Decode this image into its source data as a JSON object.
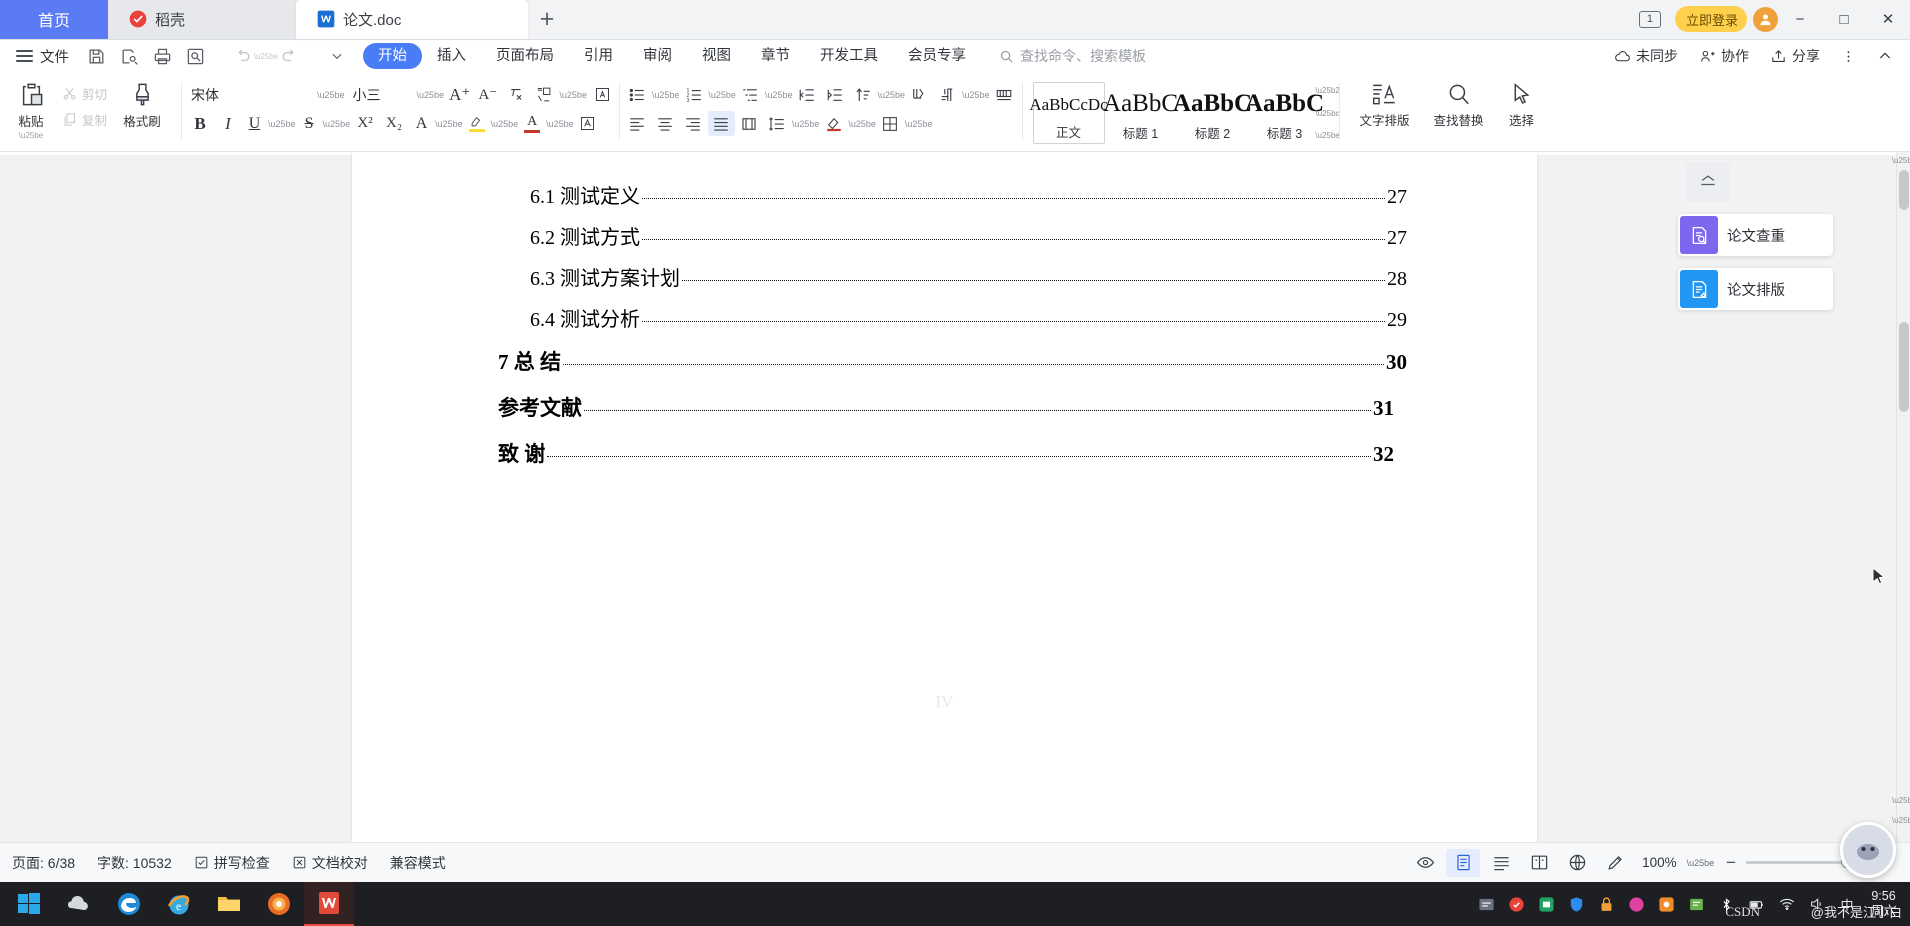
{
  "window": {
    "tabs": [
      {
        "label": "首页",
        "icon": "home-icon",
        "state": "home"
      },
      {
        "label": "稻壳",
        "icon": "docer-icon",
        "state": "inactive"
      },
      {
        "label": "论文.doc",
        "icon": "wps-word-icon",
        "state": "active"
      }
    ],
    "new_tab_label": "+",
    "tab_count_badge": "1",
    "login_label": "立即登录",
    "avatar_label": "人",
    "minimize": "−",
    "maximize": "□",
    "close": "✕"
  },
  "menubar": {
    "file_label": "文件",
    "quick_access": [
      "save-icon",
      "save-as-icon",
      "print-icon",
      "print-preview-icon",
      "undo-icon",
      "redo-icon",
      "customize-icon"
    ],
    "tabs": [
      {
        "label": "开始",
        "selected": true
      },
      {
        "label": "插入",
        "selected": false
      },
      {
        "label": "页面布局",
        "selected": false
      },
      {
        "label": "引用",
        "selected": false
      },
      {
        "label": "审阅",
        "selected": false
      },
      {
        "label": "视图",
        "selected": false
      },
      {
        "label": "章节",
        "selected": false
      },
      {
        "label": "开发工具",
        "selected": false
      },
      {
        "label": "会员专享",
        "selected": false
      }
    ],
    "search_placeholder": "查找命令、搜索模板",
    "right": [
      {
        "label": "未同步",
        "icon": "cloud-sync-icon"
      },
      {
        "label": "协作",
        "icon": "collaborate-icon"
      },
      {
        "label": "分享",
        "icon": "share-icon"
      }
    ],
    "more_icon": "more-vertical-icon",
    "collapse_icon": "chevron-up-icon"
  },
  "ribbon": {
    "paste_label": "粘贴",
    "cut_label": "剪切",
    "copy_label": "复制",
    "format_painter_label": "格式刷",
    "font_name": "宋体",
    "font_size": "小三",
    "grow_font": "A⁺",
    "shrink_font": "A⁻",
    "clear_format": "clear-format-icon",
    "pinyin_guide": "pinyin-icon",
    "bold": "B",
    "italic": "I",
    "underline": "U",
    "strikethrough": "S",
    "superscript": "X²",
    "subscript": "X₂",
    "text_effect": "A",
    "highlight": "A",
    "font_color": "A",
    "char_border": "A",
    "styles": [
      {
        "preview": "AaBbCcDc",
        "name": "正文",
        "current": true
      },
      {
        "preview": "AaBbC",
        "name": "标题 1",
        "current": false
      },
      {
        "preview": "AaBbC",
        "name": "标题 2",
        "current": false
      },
      {
        "preview": "AaBbC",
        "name": "标题 3",
        "current": false
      }
    ],
    "text_layout_label": "文字排版",
    "find_replace_label": "查找替换",
    "select_label": "选择"
  },
  "document": {
    "toc": [
      {
        "text": "6.1 测试定义",
        "page": "27",
        "level": 2
      },
      {
        "text": "6.2 测试方式",
        "page": "27",
        "level": 2
      },
      {
        "text": "6.3 测试方案计划",
        "page": "28",
        "level": 2
      },
      {
        "text": "6.4 测试分析",
        "page": "29",
        "level": 2
      },
      {
        "text": "7  总  结",
        "page": "30",
        "level": 1
      },
      {
        "text": "参考文献",
        "page": "31",
        "level": 1
      },
      {
        "text": "致    谢",
        "page": "32",
        "level": 1
      }
    ],
    "watermark": "IV"
  },
  "right_panel": {
    "collapse_icon": "panel-collapse-icon",
    "cards": [
      {
        "label": "论文查重",
        "icon": "paper-check-icon",
        "color": "#7b68ee"
      },
      {
        "label": "论文排版",
        "icon": "paper-layout-icon",
        "color": "#2196f3"
      }
    ]
  },
  "statusbar": {
    "page_label": "页面: 6/38",
    "word_count_label": "字数: 10532",
    "spellcheck_label": "拼写检查",
    "proofread_label": "文档校对",
    "compat_label": "兼容模式",
    "view_buttons": [
      {
        "icon": "eye-icon",
        "active": false
      },
      {
        "icon": "page-view-icon",
        "active": true
      },
      {
        "icon": "outline-view-icon",
        "active": false
      },
      {
        "icon": "reading-view-icon",
        "active": false
      },
      {
        "icon": "web-view-icon",
        "active": false
      },
      {
        "icon": "pen-icon",
        "active": false
      }
    ],
    "zoom_level": "100%",
    "zoom_out": "−",
    "zoom_in": "+"
  },
  "taskbar": {
    "start_icon": "windows-start-icon",
    "items": [
      "wps-cloud-icon",
      "edge-icon",
      "ie-icon",
      "explorer-icon",
      "firefox-icon",
      "wps-writer-icon"
    ],
    "tray_icons": [
      "input-method-icon",
      "red-app-icon",
      "green-app-icon",
      "shield-icon",
      "lock-icon",
      "pink-app-icon",
      "orange-app-icon",
      "folder-icon",
      "chart-icon",
      "bluetooth-icon",
      "battery-icon",
      "network-icon",
      "volume-icon"
    ],
    "ime_label": "中",
    "time": "9:56",
    "date": "周六",
    "watermark_csdn": "CSDN",
    "watermark_user": "@我不是江小白"
  },
  "colors": {
    "accent": "#4a7cf7",
    "tab_home": "#5b7bf5",
    "login_pill": "#ffd04b",
    "taskbar": "#1d1f22",
    "workspace_bg": "#f2f2f2"
  }
}
